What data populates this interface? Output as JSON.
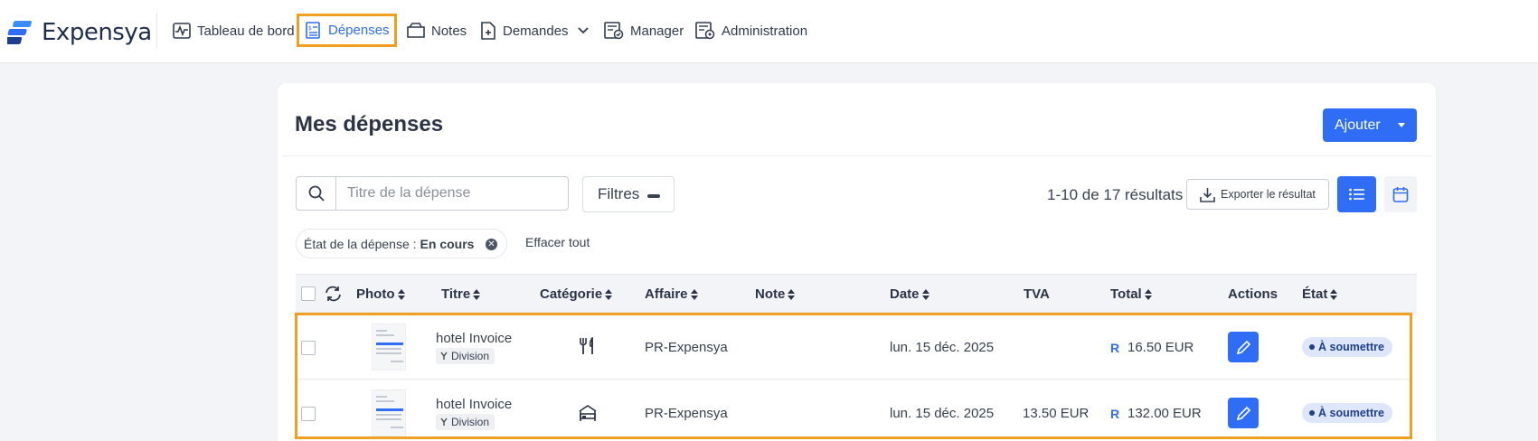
{
  "app": {
    "name": "Expensya"
  },
  "nav": [
    {
      "id": "dashboard",
      "label": "Tableau de bord",
      "icon": "dashboard-chart-icon"
    },
    {
      "id": "expenses",
      "label": "Dépenses",
      "icon": "receipt-icon",
      "active": true
    },
    {
      "id": "notes",
      "label": "Notes",
      "icon": "folder-icon"
    },
    {
      "id": "requests",
      "label": "Demandes",
      "icon": "document-plus-icon"
    },
    {
      "id": "manager",
      "label": "Manager",
      "icon": "manager-approval-icon"
    },
    {
      "id": "admin",
      "label": "Administration",
      "icon": "admin-settings-icon"
    }
  ],
  "page": {
    "title": "Mes dépenses",
    "add_label": "Ajouter"
  },
  "toolbar": {
    "search_placeholder": "Titre de la dépense",
    "filters_label": "Filtres",
    "results": "1-10 de 17 résultats",
    "export_label": "Exporter le résultat"
  },
  "active_filter": {
    "label": "État de la dépense :",
    "value": "En cours",
    "clear_all": "Effacer tout"
  },
  "table": {
    "columns": [
      "Photo",
      "Titre",
      "Catégorie",
      "Affaire",
      "Note",
      "Date",
      "TVA",
      "Total",
      "Actions",
      "État"
    ],
    "rows": [
      {
        "title": "hotel Invoice",
        "division": "Division",
        "category_icon": "restaurant-icon",
        "affaire": "PR-Expensya",
        "note": "",
        "date": "lun. 15 déc. 2025",
        "tva": "",
        "total_marker": "R",
        "total": "16.50 EUR",
        "status": "À soumettre"
      },
      {
        "title": "hotel Invoice",
        "division": "Division",
        "category_icon": "hotel-icon",
        "affaire": "PR-Expensya",
        "note": "",
        "date": "lun. 15 déc. 2025",
        "tva": "13.50 EUR",
        "total_marker": "R",
        "total": "132.00 EUR",
        "status": "À soumettre"
      }
    ]
  },
  "colors": {
    "accent": "#2f6df6",
    "highlight": "#f0a020",
    "badge_bg": "#dde6fb",
    "badge_text": "#1f3f8c"
  }
}
